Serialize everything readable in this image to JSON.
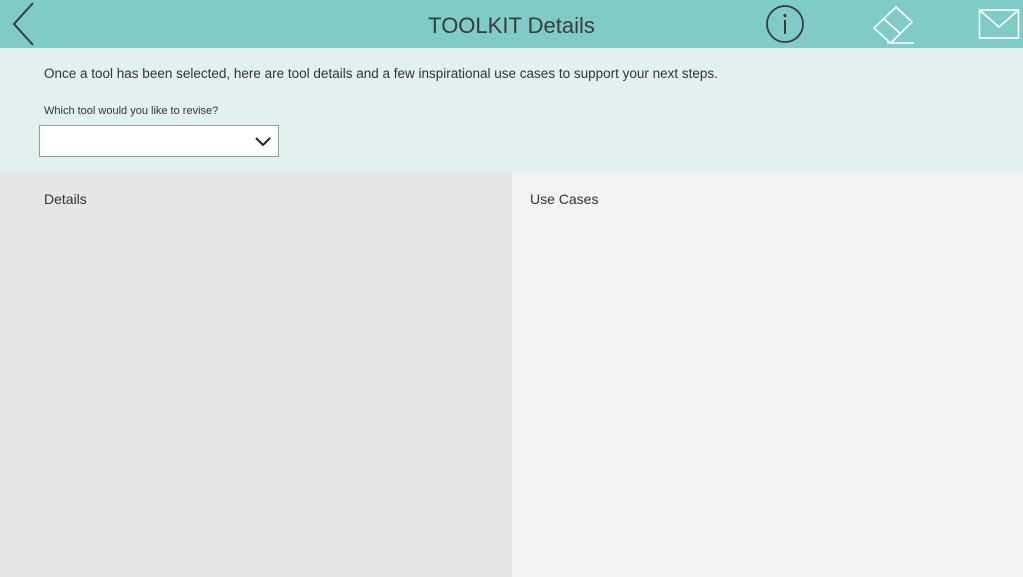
{
  "header": {
    "title": "TOOLKIT Details",
    "background_color": "#7fccc6",
    "icons": {
      "back": "chevron-left-icon",
      "info": "info-icon",
      "eraser": "eraser-icon",
      "mail": "mail-icon"
    }
  },
  "intro": {
    "text": "Once a tool has been selected, here are tool details and a few inspirational use cases to support your next steps.",
    "select_label": "Which tool would you like to revise?",
    "select_value": "",
    "background_color": "#e0f1f0"
  },
  "details": {
    "title": "Details",
    "background_color": "#e6e6e6"
  },
  "use_cases": {
    "title": "Use Cases",
    "background_color": "#f2f2f2"
  }
}
